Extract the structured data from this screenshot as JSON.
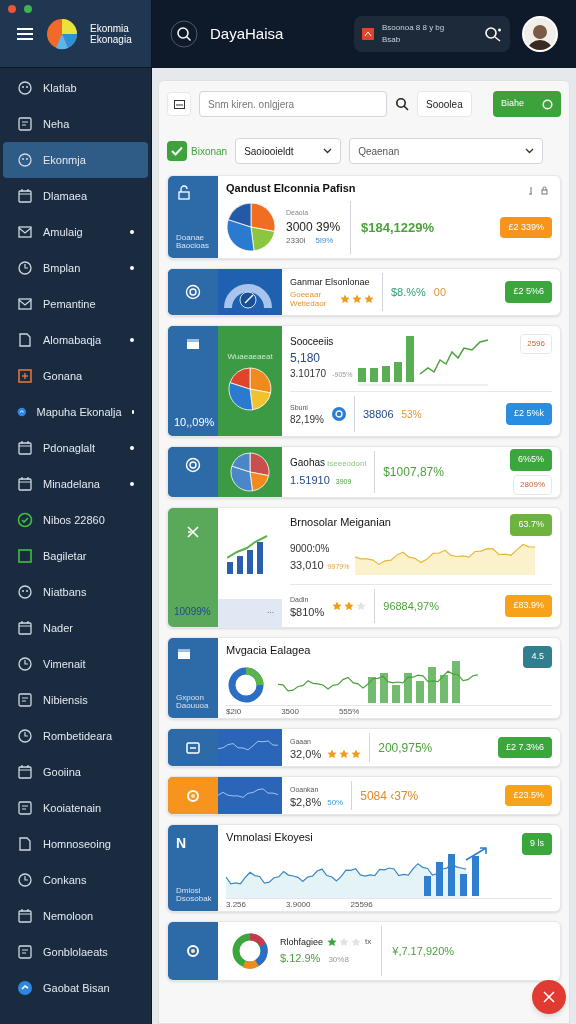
{
  "window": {
    "controls": [
      {
        "color": "#e8553b"
      },
      {
        "color": "#3cb54a"
      }
    ]
  },
  "sidebar": {
    "brand": [
      "Ekonmia",
      "Ekonagia"
    ],
    "items": [
      {
        "label": "Klatlab",
        "selected": false,
        "dot": false
      },
      {
        "label": "Neha",
        "selected": false,
        "dot": false
      },
      {
        "label": "Ekonmja",
        "selected": true,
        "dot": false
      },
      {
        "label": "Dlamaea",
        "selected": false,
        "dot": false
      },
      {
        "label": "Amulaig",
        "selected": false,
        "dot": true
      },
      {
        "label": "Bmplan",
        "selected": false,
        "dot": true
      },
      {
        "label": "Pemantine",
        "selected": false,
        "dot": false
      },
      {
        "label": "Alomabaqja",
        "selected": false,
        "dot": true
      },
      {
        "label": "Gonana",
        "selected": false,
        "dot": false
      },
      {
        "label": "Mapuha Ekonalja",
        "selected": false,
        "dot": true
      },
      {
        "label": "Pdonaglalt",
        "selected": false,
        "dot": true
      },
      {
        "label": "Minadelana",
        "selected": false,
        "dot": true
      },
      {
        "label": "Nibos 22860",
        "selected": false,
        "dot": false
      },
      {
        "label": "Bagiletar",
        "selected": false,
        "dot": false
      },
      {
        "label": "Niatbans",
        "selected": false,
        "dot": false
      },
      {
        "label": "Nader",
        "selected": false,
        "dot": false
      },
      {
        "label": "Vimenait",
        "selected": false,
        "dot": false
      },
      {
        "label": "Nibiensis",
        "selected": false,
        "dot": false
      },
      {
        "label": "Rombetideara",
        "selected": false,
        "dot": false
      },
      {
        "label": "Gooiina",
        "selected": false,
        "dot": false
      },
      {
        "label": "Kooiatenain",
        "selected": false,
        "dot": false
      },
      {
        "label": "Homnoseoing",
        "selected": false,
        "dot": false
      },
      {
        "label": "Conkans",
        "selected": false,
        "dot": false
      },
      {
        "label": "Nemoloon",
        "selected": false,
        "dot": false
      },
      {
        "label": "Gonblolaeats",
        "selected": false,
        "dot": false
      },
      {
        "label": "Gaobat Bisan",
        "selected": false,
        "dot": false
      }
    ]
  },
  "header": {
    "title": "DayaHaisa",
    "notification": {
      "line_1": "Bsoonoa 8 8 y bg",
      "line_2": "Bsab"
    }
  },
  "toolbar": {
    "search": {
      "placeholder": "Snm kiren. onlgjera"
    },
    "button": "Sooolea",
    "primary_button": "Biahe"
  },
  "filters": {
    "checkbox": {
      "label": "Bixonan",
      "checked": true
    },
    "selects": [
      "Saoiooieldt",
      "Qeaenan"
    ]
  },
  "cards": [
    {
      "kind": "pie",
      "panel_text": [
        "Doanae",
        "Baocioas"
      ],
      "title": "Qandust Elconnia Pafisn",
      "caption": "Deaoia",
      "value": "3000 39%",
      "sub": "2330l",
      "change": "5l9%",
      "total": "$184,1229%",
      "badge": {
        "text": "£2 339%",
        "color": "#f7941d"
      }
    },
    {
      "kind": "gauge",
      "title": "Ganmar Elsonlonae",
      "caption": "Goeeaar Wetiedaor",
      "stars": 3,
      "change": "$8.%%",
      "extra": "00",
      "badge": {
        "text": "£2 5%6",
        "color": "#3aa63c"
      }
    },
    {
      "kind": "combo",
      "panel_text": "Wuaeaeaeat",
      "panel_value": "10,,09%",
      "title": "Sooceeiis",
      "value": "5,180",
      "sub": "3.10170",
      "change": "-905%",
      "outline_badge": "2596",
      "foot_label": "Sbuni",
      "foot_value": "82,19%",
      "total": "38806",
      "total_change": "53%",
      "badge": {
        "text": "£2 5%k",
        "color": "#2a8ee0"
      }
    },
    {
      "kind": "split",
      "title": "Gaohas",
      "tag": "Iseeeodonl",
      "value": "1.51910",
      "change": "3909",
      "total": "$1007,87%",
      "badge": {
        "text": "6%5%",
        "color": "#3aa63c"
      },
      "outline_badge": "2809%"
    },
    {
      "kind": "area",
      "title": "Brnosolar Meiganian",
      "panel_value": "10099%",
      "panel_note": "···",
      "value": "9000:0%",
      "sub": "33,010",
      "change": "9979%",
      "badge": {
        "text": "63.7%",
        "color": "#6db33f"
      },
      "foot_label": "Dadin",
      "foot_value": "$810%",
      "stars": 2,
      "total": "96884,97%",
      "foot_badge": {
        "text": "£83.9%",
        "color": "#f7a21b"
      }
    },
    {
      "kind": "mixed",
      "title": "Mvgacia Ealagea",
      "panel_text": [
        "Gxpoon",
        "Daouuoa"
      ],
      "axis": [
        "$2l0",
        "3500",
        "555%"
      ],
      "badge": {
        "text": "4.5",
        "color": "#2f7f8f"
      }
    },
    {
      "kind": "line",
      "color": "#2d6aa8",
      "caption": "Gaaan",
      "value": "32,0%",
      "stars": 3,
      "total": "200,975%",
      "badge": {
        "text": "£2 7.3%6",
        "color": "#3aa63c"
      }
    },
    {
      "kind": "line",
      "color": "#f7941d",
      "caption": "Ooankan",
      "value": "$2,8%",
      "change": "50%",
      "total": "5084 ‹37%",
      "badge": {
        "text": "£23.5%",
        "color": "#f7a21b"
      }
    },
    {
      "kind": "trend",
      "title": "Vmnolasi Ekoyesi",
      "panel_letter": "N",
      "panel_text": [
        "Dmiosi",
        "Dsosobak"
      ],
      "axis": [
        "3.256",
        "3.9000",
        "25596"
      ],
      "badge": {
        "text": "9 ls",
        "color": "#3aa63c"
      }
    },
    {
      "kind": "donut",
      "caption": "Rlohfagiee",
      "stars": 1,
      "mark": "tx",
      "value": "$.12.9%",
      "change": "30%8",
      "total": "¥,7.17,920%"
    }
  ]
}
